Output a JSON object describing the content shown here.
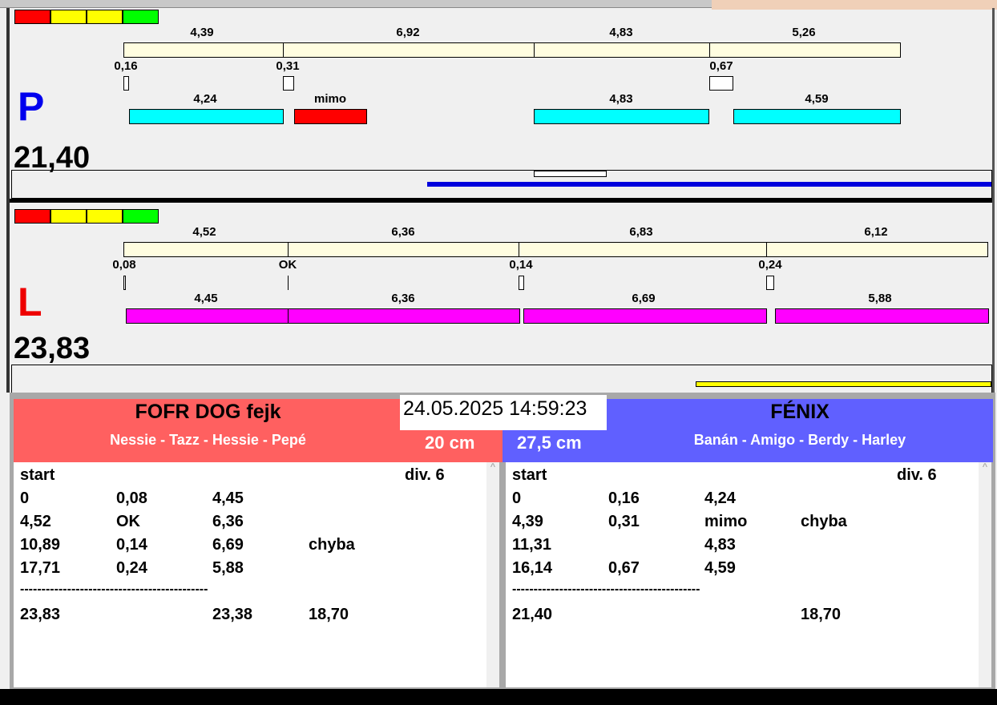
{
  "colors": {
    "legend": [
      "#ff0000",
      "#ffff00",
      "#ffff00",
      "#00ff00"
    ],
    "left_team": "#ff6060",
    "right_team": "#6060ff"
  },
  "p": {
    "letter": "P",
    "total": "21,40",
    "top": [
      "4,39",
      "6,92",
      "4,83",
      "5,26"
    ],
    "small": [
      "0,16",
      "0,31",
      "0,67"
    ],
    "bottom": [
      "4,24",
      "mimo",
      "4,83",
      "4,59"
    ]
  },
  "l": {
    "letter": "L",
    "total": "23,83",
    "top": [
      "4,52",
      "6,36",
      "6,83",
      "6,12"
    ],
    "small": [
      "0,08",
      "OK",
      "0,14",
      "0,24"
    ],
    "bottom": [
      "4,45",
      "6,36",
      "6,69",
      "5,88"
    ]
  },
  "datetime": "24.05.2025 14:59:23",
  "left": {
    "team": "FOFR DOG fejk",
    "dogs": "Nessie - Tazz - Hessie - Pepé",
    "height": "20 cm",
    "start": "start",
    "div": "div.  6",
    "rows": [
      [
        "0",
        "0,08",
        "4,45",
        ""
      ],
      [
        "4,52",
        "OK",
        "6,36",
        ""
      ],
      [
        "10,89",
        "0,14",
        "6,69",
        "chyba"
      ],
      [
        "17,71",
        "0,24",
        "5,88",
        ""
      ]
    ],
    "dashes": "--------------------------------------------",
    "total": [
      "23,83",
      "",
      "23,38",
      "18,70"
    ]
  },
  "right": {
    "team": "FÉNIX",
    "dogs": "Banán - Amigo - Berdy - Harley",
    "height": "27,5 cm",
    "start": "start",
    "div": "div.  6",
    "rows": [
      [
        "0",
        "0,16",
        "4,24",
        ""
      ],
      [
        "4,39",
        "0,31",
        "mimo",
        "chyba"
      ],
      [
        "11,31",
        "",
        "4,83",
        ""
      ],
      [
        "16,14",
        "0,67",
        "4,59",
        ""
      ]
    ],
    "dashes": "--------------------------------------------",
    "total": [
      "21,40",
      "",
      "",
      "18,70"
    ]
  }
}
